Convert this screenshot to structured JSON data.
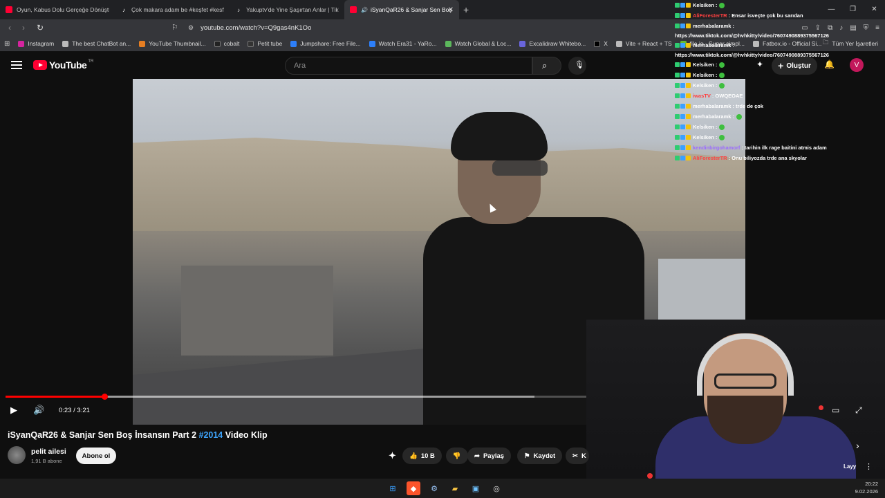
{
  "browser": {
    "tabs": [
      {
        "label": "Oyun, Kabus Dolu Gerçeğe Dönüştü!",
        "icon": "youtube-icon",
        "active": false
      },
      {
        "label": "Çok makara adam be #keşfet #kesfet",
        "icon": "tiktok-icon",
        "active": false
      },
      {
        "label": "Yakuptv'de Yine Şaşırtan Anlar | TikTok",
        "icon": "tiktok-icon",
        "active": false
      },
      {
        "label": "iSyanQaR26 & Sanjar Sen Boş",
        "icon": "youtube-icon",
        "active": true
      }
    ],
    "new_tab": "+",
    "url": "youtube.com/watch?v=Q9gas4nK1Oo",
    "bookmarks": [
      {
        "label": "Instagram",
        "color": "#d6249f"
      },
      {
        "label": "The best ChatBot an...",
        "color": "#bbbbbb"
      },
      {
        "label": "YouTube Thumbnail...",
        "color": "#e67e22"
      },
      {
        "label": "cobalt",
        "color": "#222222"
      },
      {
        "label": "Petit tube",
        "color": "#333333"
      },
      {
        "label": "Jumpshare: Free File...",
        "color": "#2d7ff9"
      },
      {
        "label": "Watch Era31 - YaRo...",
        "color": "#2d7ff9"
      },
      {
        "label": "Watch Global & Loc...",
        "color": "#5cb85c"
      },
      {
        "label": "Excalidraw Whitebo...",
        "color": "#6965db"
      },
      {
        "label": "X",
        "color": "#000000"
      },
      {
        "label": "Vite + React + TS",
        "color": "#bbbbbb"
      },
      {
        "label": "file.io - Super simpl...",
        "color": "#66bb33"
      },
      {
        "label": "Fatbox.io - Official Si...",
        "color": "#bbbbbb"
      }
    ],
    "bookmarks_all": "Tüm Yer İşaretleri"
  },
  "youtube": {
    "logo_text": "YouTube",
    "region": "TR",
    "search_placeholder": "Ara",
    "create_label": "Oluştur",
    "avatar_letter": "V"
  },
  "player": {
    "current_time": "0:23",
    "duration": "3:21",
    "time_display": "0:23 / 3:21",
    "progress_fraction": 0.1144,
    "buffered_fraction": 0.61
  },
  "video": {
    "title_main": "iSyanQaR26 & Sanjar Sen Boş İnsansın Part 2 ",
    "title_hashtag": "#2014",
    "title_suffix": " Video Klip",
    "channel_name": "pelit ailesi",
    "channel_subs": "1,91 B abone",
    "subscribe_label": "Abone ol",
    "likes": "10 B",
    "share_label": "Paylaş",
    "save_label": "Kaydet",
    "clip_label": "K",
    "overflow_text": "Layy"
  },
  "chat": [
    {
      "user": "Kelsiken",
      "user_color": "#ffffff",
      "message": ":",
      "emote": true
    },
    {
      "user": "AliForesterTR",
      "user_color": "#ff4040",
      "message": ": Ensar isveçte çok bu sarıdan",
      "emote": false
    },
    {
      "user": "merhabalaramk",
      "user_color": "#ffffff",
      "message": ":",
      "emote": false,
      "url": "https://www.tiktok.com/@hvhkitty/video/7607490889375567126"
    },
    {
      "user": "merhabalaramk",
      "user_color": "#ffffff",
      "message": ":",
      "emote": false,
      "url": "https://www.tiktok.com/@hvhkitty/video/7607490889375567126"
    },
    {
      "user": "Kelsiken",
      "user_color": "#ffffff",
      "message": ":",
      "emote": true
    },
    {
      "user": "Kelsiken",
      "user_color": "#ffffff",
      "message": ":",
      "emote": true
    },
    {
      "user": "Kelsiken",
      "user_color": "#ffffff",
      "message": ":",
      "emote": true
    },
    {
      "user": "iwasTV",
      "user_color": "#ff4040",
      "message": ": OWQEOAE",
      "emote": false
    },
    {
      "user": "merhabalaramk",
      "user_color": "#ffffff",
      "message": ": trde de çok",
      "emote": false
    },
    {
      "user": "merhabalaramk",
      "user_color": "#ffffff",
      "message": ":",
      "emote": true
    },
    {
      "user": "Kelsiken",
      "user_color": "#ffffff",
      "message": ":",
      "emote": true
    },
    {
      "user": "Kelsiken",
      "user_color": "#ffffff",
      "message": ":",
      "emote": true
    },
    {
      "user": "kendinbirgohamorf",
      "user_color": "#9b6bff",
      "message": ": tarihin ilk rage baitini atmis adam",
      "emote": false
    },
    {
      "user": "AliForesterTR",
      "user_color": "#ff4040",
      "message": ": Onu biliyozda trde ana skyolar",
      "emote": false
    }
  ],
  "taskbar": {
    "time": "20:22",
    "date": "9.02.2026"
  }
}
